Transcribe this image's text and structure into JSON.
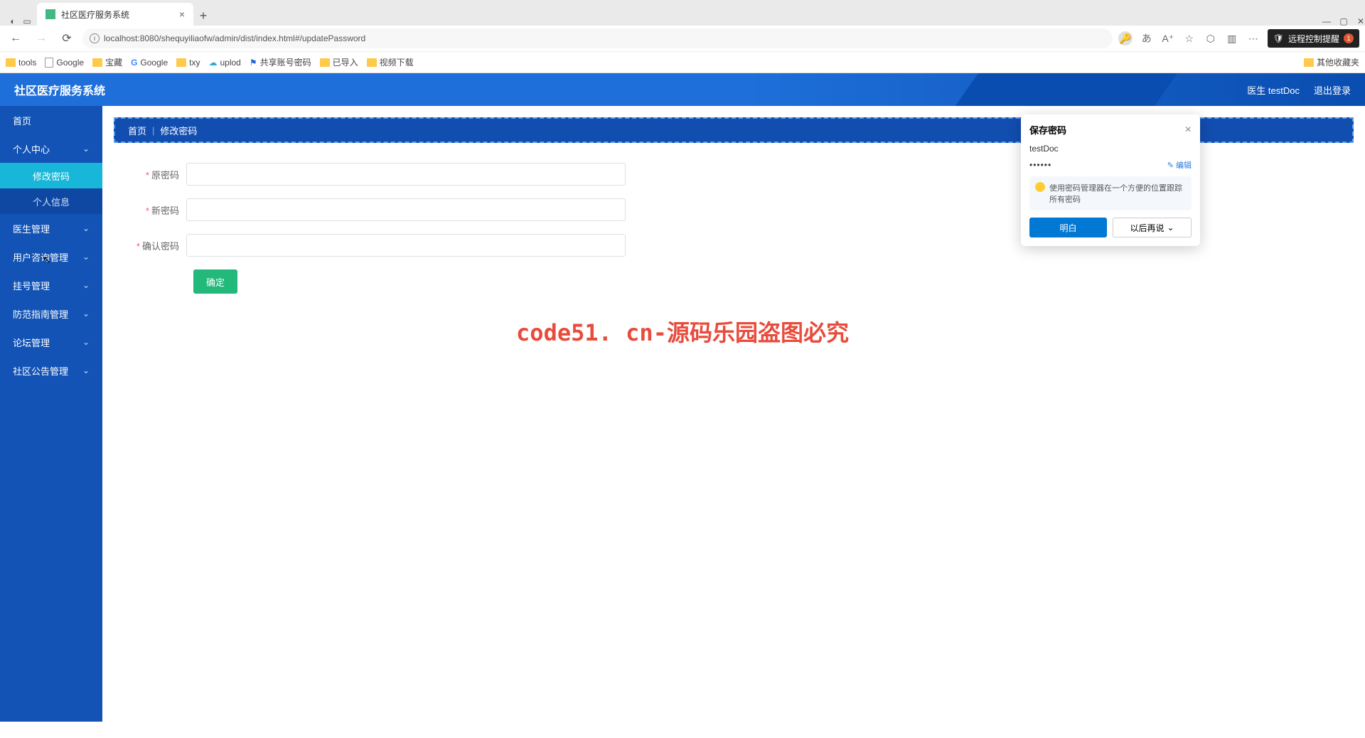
{
  "browser": {
    "tab_title": "社区医疗服务系统",
    "url": "localhost:8080/shequyiliaofw/admin/dist/index.html#/updatePassword",
    "remote_notice": "远程控制提醒",
    "remote_badge": "1",
    "bookmarks": [
      "tools",
      "Google",
      "宝藏",
      "Google",
      "txy",
      "uplod",
      "共享账号密码",
      "已导入",
      "视频下载"
    ],
    "bookmark_right": "其他收藏夹"
  },
  "app": {
    "title": "社区医疗服务系统",
    "user_label": "医生 testDoc",
    "logout": "退出登录"
  },
  "sidebar": {
    "home": "首页",
    "items": [
      {
        "label": "个人中心",
        "children": [
          "修改密码",
          "个人信息"
        ]
      },
      {
        "label": "医生管理"
      },
      {
        "label": "用户咨询管理"
      },
      {
        "label": "挂号管理"
      },
      {
        "label": "防范指南管理"
      },
      {
        "label": "论坛管理"
      },
      {
        "label": "社区公告管理"
      }
    ]
  },
  "breadcrumb": {
    "home": "首页",
    "current": "修改密码"
  },
  "form": {
    "old_pwd": "原密码",
    "new_pwd": "新密码",
    "confirm_pwd": "确认密码",
    "submit": "确定"
  },
  "pwd_dialog": {
    "title": "保存密码",
    "username": "testDoc",
    "password_mask": "••••••",
    "edit": "编辑",
    "tip": "使用密码管理器在一个方便的位置跟踪所有密码",
    "ok": "明白",
    "later": "以后再说"
  },
  "watermark": {
    "text": "code51.cn",
    "big": "code51. cn-源码乐园盗图必究"
  }
}
